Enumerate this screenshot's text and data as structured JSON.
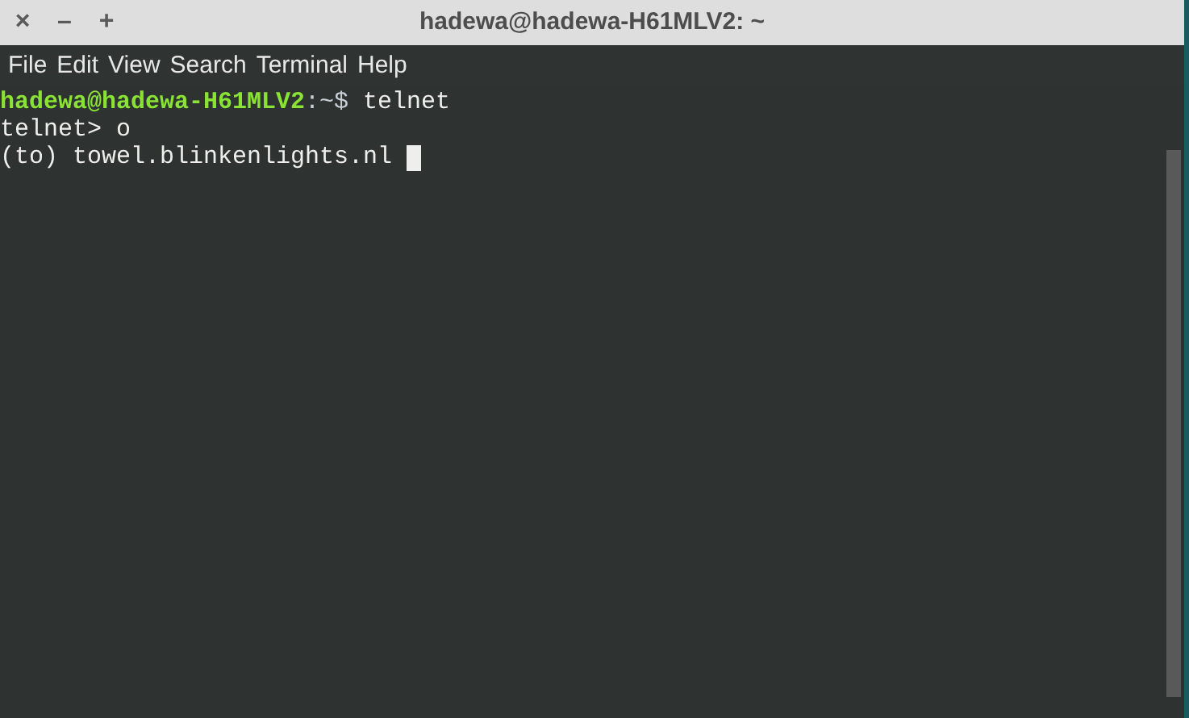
{
  "window": {
    "title": "hadewa@hadewa-H61MLV2: ~",
    "controls": [
      "×",
      "–",
      "+"
    ]
  },
  "menu": [
    "File",
    "Edit",
    "View",
    "Search",
    "Terminal",
    "Help"
  ],
  "terminal": {
    "lines": [
      {
        "segments": [
          {
            "kind": "user_host",
            "text": "hadewa@hadewa-H61MLV2"
          },
          {
            "kind": "path",
            "text": ":~$"
          },
          {
            "kind": "plain",
            "text": " telnet"
          }
        ],
        "cursor": false
      },
      {
        "segments": [
          {
            "kind": "plain",
            "text": "telnet> o"
          }
        ],
        "cursor": false
      },
      {
        "segments": [
          {
            "kind": "plain",
            "text": "(to) towel.blinkenlights.nl "
          }
        ],
        "cursor": true
      }
    ]
  }
}
